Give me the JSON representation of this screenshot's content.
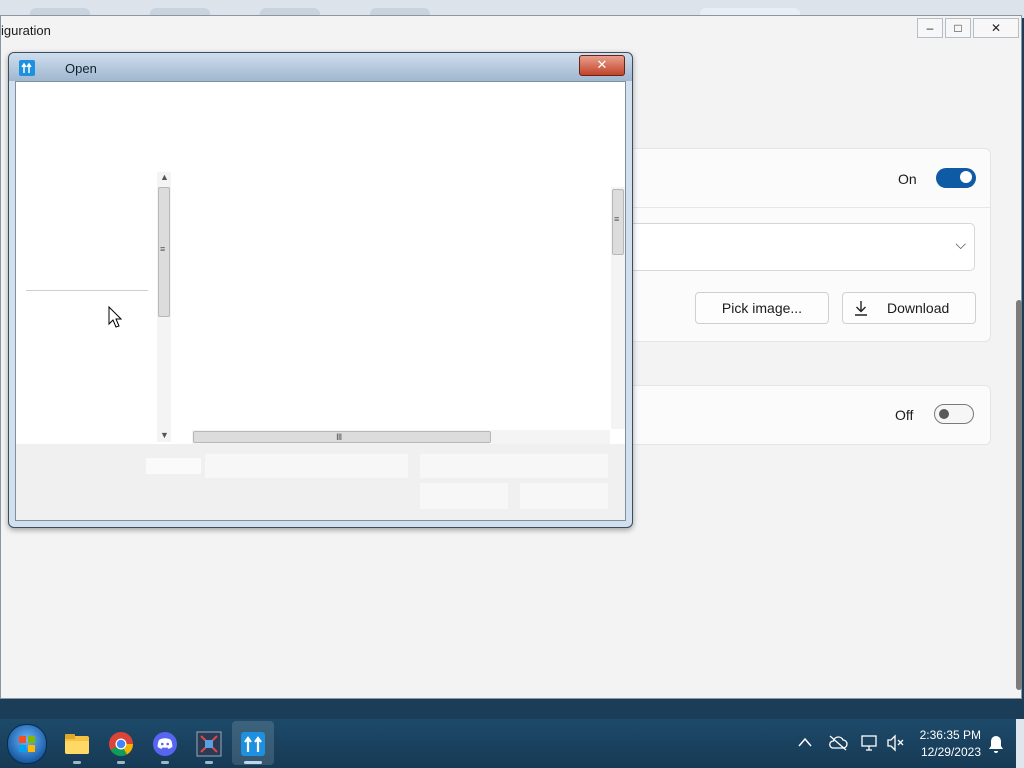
{
  "main_window": {
    "title": "iguration",
    "caption_buttons": {
      "minimize": "–",
      "maximize": "□",
      "close": "✕"
    },
    "card1": {
      "toggle_label": "On",
      "toggle_state": "on",
      "pick_image_label": "Pick image...",
      "download_label": "Download",
      "dropdown_chevron": "⌵"
    },
    "card2": {
      "toggle_label": "Off",
      "toggle_state": "off"
    }
  },
  "open_dialog": {
    "title": "Open",
    "close_label": "✕",
    "hscroll_grip": "Ⅲ",
    "vscroll_grip": "≡",
    "arrow_up": "▲",
    "arrow_down": "▼"
  },
  "taskbar": {
    "pinned": [
      {
        "name": "file-explorer-icon"
      },
      {
        "name": "chrome-icon"
      },
      {
        "name": "discord-icon"
      },
      {
        "name": "app-icon"
      },
      {
        "name": "upload-app-icon"
      }
    ],
    "clock_time": "2:36:35 PM",
    "clock_date": "12/29/2023"
  },
  "colors": {
    "accent": "#0f5aa5",
    "taskbar": "#163a55",
    "dialog_close": "#c2432a"
  }
}
